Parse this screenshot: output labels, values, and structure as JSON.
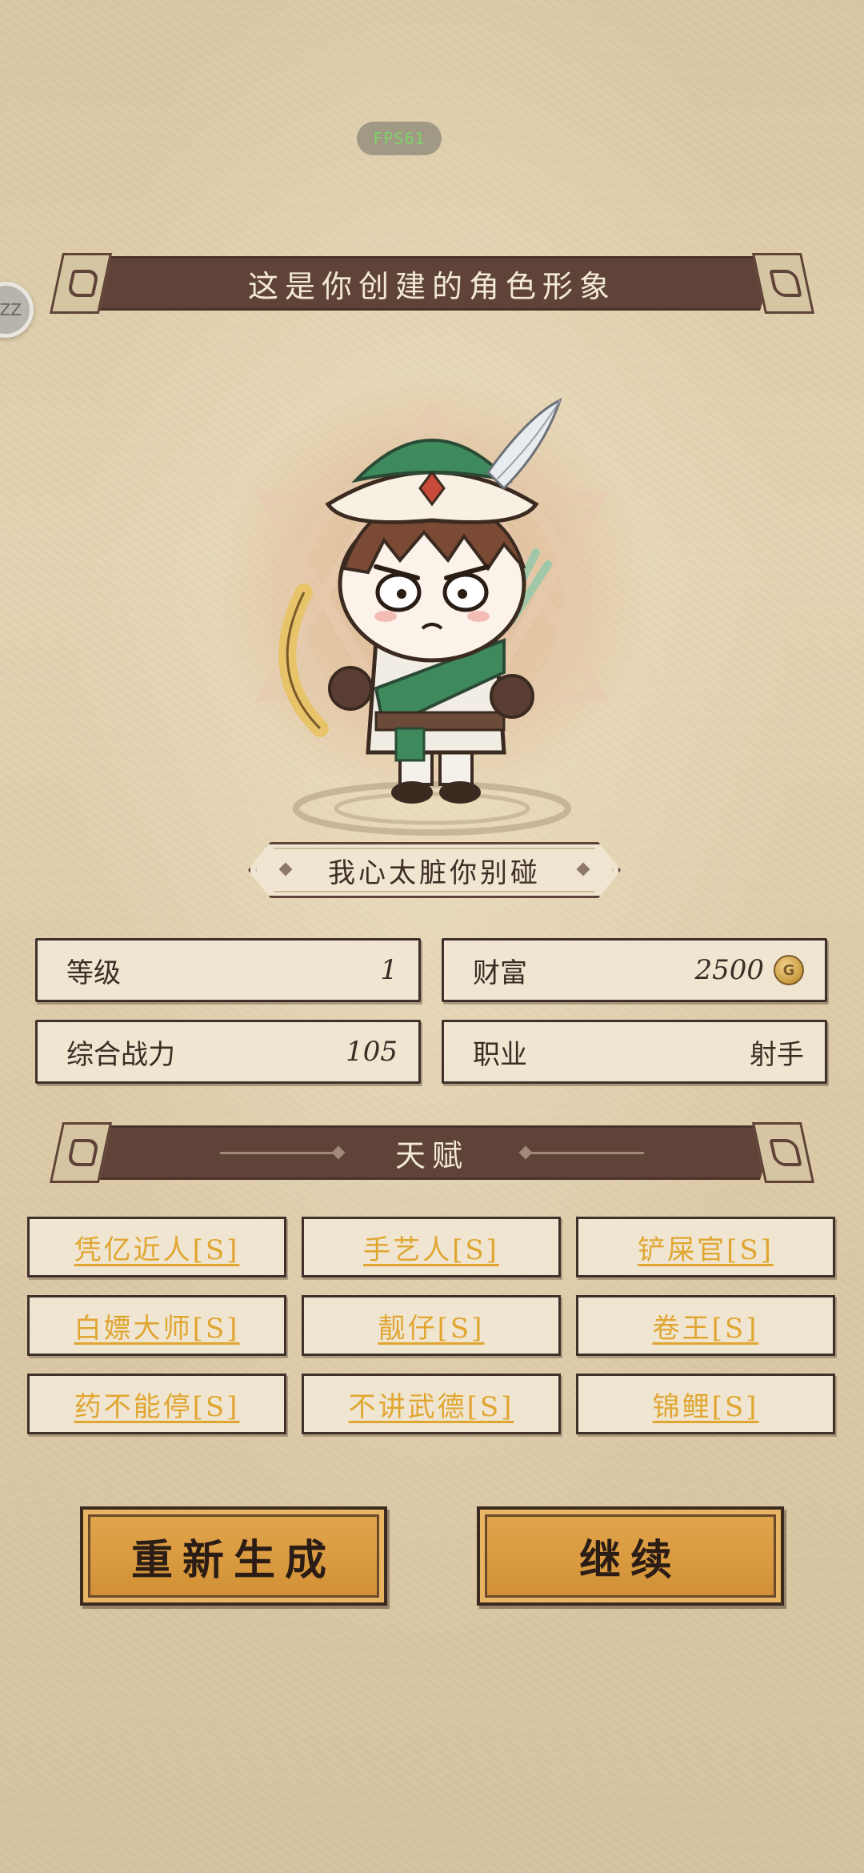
{
  "fps": "FPS61",
  "side_button": "ZZ",
  "header": {
    "title": "这是你创建的角色形象"
  },
  "character": {
    "name": "我心太脏你别碰"
  },
  "stats": {
    "level_label": "等级",
    "level_value": "1",
    "wealth_label": "财富",
    "wealth_value": "2500",
    "power_label": "综合战力",
    "power_value": "105",
    "job_label": "职业",
    "job_value": "射手"
  },
  "talents_header": {
    "title": "天赋"
  },
  "talents": [
    "凭亿近人[S]",
    "手艺人[S]",
    "铲屎官[S]",
    "白嫖大师[S]",
    "靓仔[S]",
    "卷王[S]",
    "药不能停[S]",
    "不讲武德[S]",
    "锦鲤[S]"
  ],
  "actions": {
    "regenerate": "重新生成",
    "continue": "继续"
  },
  "colors": {
    "banner": "#5f4338",
    "talent_text": "#e0a631",
    "button": "#d9993e"
  },
  "icons": {
    "coin": "coin-icon",
    "character": "archer-character-illustration"
  }
}
